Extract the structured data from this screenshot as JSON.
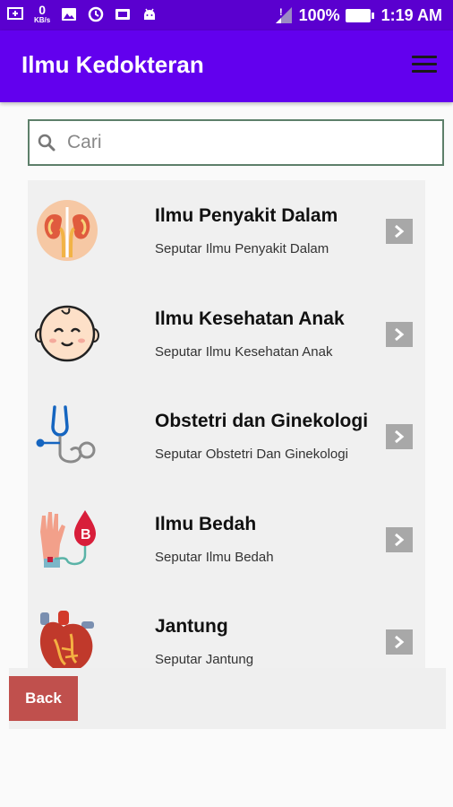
{
  "status_bar": {
    "kbs_value": "0",
    "kbs_unit": "KB/s",
    "battery": "100%",
    "time": "1:19 AM"
  },
  "app_bar": {
    "title": "Ilmu Kedokteran"
  },
  "search": {
    "placeholder": "Cari",
    "value": ""
  },
  "list": [
    {
      "title": "Ilmu Penyakit Dalam",
      "subtitle": "Seputar Ilmu Penyakit Dalam",
      "icon": "kidney-icon"
    },
    {
      "title": "Ilmu Kesehatan Anak",
      "subtitle": "Seputar Ilmu Kesehatan Anak",
      "icon": "baby-face-icon"
    },
    {
      "title": "Obstetri dan Ginekologi",
      "subtitle": "Seputar Obstetri Dan Ginekologi",
      "icon": "stethoscope-icon"
    },
    {
      "title": "Ilmu Bedah",
      "subtitle": "Seputar Ilmu Bedah",
      "icon": "blood-transfusion-icon"
    },
    {
      "title": "Jantung",
      "subtitle": "Seputar Jantung",
      "icon": "heart-icon"
    }
  ],
  "footer": {
    "back_label": "Back"
  },
  "colors": {
    "status_bar": "#5a00cf",
    "app_bar": "#6200ee",
    "back_button": "#c0504d",
    "search_border": "#5d7f6a",
    "list_background": "#f0f0f0",
    "arrow_button": "#a8a8a8"
  }
}
